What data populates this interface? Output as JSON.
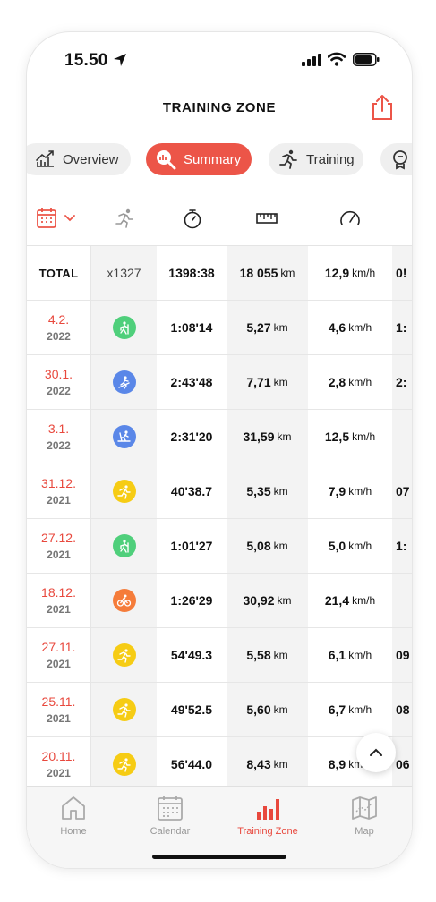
{
  "status": {
    "time": "15.50"
  },
  "header": {
    "title": "TRAINING ZONE"
  },
  "tabs": [
    {
      "label": "Overview",
      "icon": "chart-line-icon"
    },
    {
      "label": "Summary",
      "icon": "search-chart-icon"
    },
    {
      "label": "Training",
      "icon": "runner-icon"
    }
  ],
  "column_icons": [
    "calendar-icon",
    "runner-icon",
    "stopwatch-icon",
    "ruler-icon",
    "speedometer-icon"
  ],
  "total": {
    "label": "TOTAL",
    "count": "x1327",
    "duration": "1398:38",
    "distance": "18 055",
    "distance_unit": "km",
    "speed": "12,9",
    "speed_unit": "km/h",
    "next": "0!"
  },
  "rows": [
    {
      "date": "4.2.",
      "year": "2022",
      "activity": "hiking",
      "color": "#4fcf7b",
      "duration": "1:08'14",
      "distance": "5,27",
      "distance_unit": "km",
      "speed": "4,6",
      "speed_unit": "km/h",
      "next": "1:"
    },
    {
      "date": "30.1.",
      "year": "2022",
      "activity": "skiing",
      "color": "#5a87e8",
      "duration": "2:43'48",
      "distance": "7,71",
      "distance_unit": "km",
      "speed": "2,8",
      "speed_unit": "km/h",
      "next": "2:"
    },
    {
      "date": "3.1.",
      "year": "2022",
      "activity": "cross-country-skiing",
      "color": "#5a87e8",
      "duration": "2:31'20",
      "distance": "31,59",
      "distance_unit": "km",
      "speed": "12,5",
      "speed_unit": "km/h",
      "next": ""
    },
    {
      "date": "31.12.",
      "year": "2021",
      "activity": "running",
      "color": "#f6cc14",
      "duration": "40'38.7",
      "distance": "5,35",
      "distance_unit": "km",
      "speed": "7,9",
      "speed_unit": "km/h",
      "next": "07"
    },
    {
      "date": "27.12.",
      "year": "2021",
      "activity": "hiking",
      "color": "#4fcf7b",
      "duration": "1:01'27",
      "distance": "5,08",
      "distance_unit": "km",
      "speed": "5,0",
      "speed_unit": "km/h",
      "next": "1:"
    },
    {
      "date": "18.12.",
      "year": "2021",
      "activity": "cycling",
      "color": "#f57c3a",
      "duration": "1:26'29",
      "distance": "30,92",
      "distance_unit": "km",
      "speed": "21,4",
      "speed_unit": "km/h",
      "next": ""
    },
    {
      "date": "27.11.",
      "year": "2021",
      "activity": "running",
      "color": "#f6cc14",
      "duration": "54'49.3",
      "distance": "5,58",
      "distance_unit": "km",
      "speed": "6,1",
      "speed_unit": "km/h",
      "next": "09"
    },
    {
      "date": "25.11.",
      "year": "2021",
      "activity": "running",
      "color": "#f6cc14",
      "duration": "49'52.5",
      "distance": "5,60",
      "distance_unit": "km",
      "speed": "6,7",
      "speed_unit": "km/h",
      "next": "08"
    },
    {
      "date": "20.11.",
      "year": "2021",
      "activity": "running",
      "color": "#f6cc14",
      "duration": "56'44.0",
      "distance": "8,43",
      "distance_unit": "km",
      "speed": "8,9",
      "speed_unit": "km/h",
      "next": "06"
    }
  ],
  "bottom_nav": [
    {
      "label": "Home",
      "icon": "home-icon"
    },
    {
      "label": "Calendar",
      "icon": "calendar-icon"
    },
    {
      "label": "Training Zone",
      "icon": "bar-chart-icon"
    },
    {
      "label": "Map",
      "icon": "map-icon"
    }
  ],
  "colors": {
    "accent": "#ec5548",
    "date_red": "#e8483d"
  }
}
